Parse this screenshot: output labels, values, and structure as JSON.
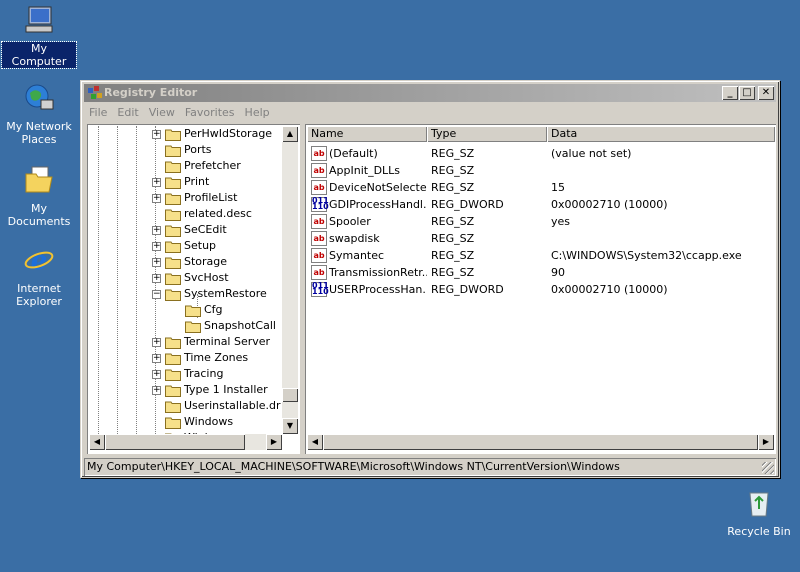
{
  "desktop": {
    "icons": [
      {
        "label": "My Computer"
      },
      {
        "label": "My Network Places"
      },
      {
        "label": "My Documents"
      },
      {
        "label": "Internet Explorer"
      },
      {
        "label": "Recycle Bin"
      }
    ]
  },
  "window": {
    "title": "Registry Editor",
    "controls": {
      "minimize": "_",
      "maximize": "□",
      "close": "✕"
    },
    "menu": [
      "File",
      "Edit",
      "View",
      "Favorites",
      "Help"
    ],
    "tree": {
      "items": [
        {
          "label": "PerHwIdStorage",
          "expander": "+"
        },
        {
          "label": "Ports",
          "expander": ""
        },
        {
          "label": "Prefetcher",
          "expander": ""
        },
        {
          "label": "Print",
          "expander": "+"
        },
        {
          "label": "ProfileList",
          "expander": "+"
        },
        {
          "label": "related.desc",
          "expander": ""
        },
        {
          "label": "SeCEdit",
          "expander": "+"
        },
        {
          "label": "Setup",
          "expander": "+"
        },
        {
          "label": "Storage",
          "expander": "+"
        },
        {
          "label": "SvcHost",
          "expander": "+"
        },
        {
          "label": "SystemRestore",
          "expander": "−"
        },
        {
          "label": "Cfg",
          "expander": ""
        },
        {
          "label": "SnapshotCall",
          "expander": ""
        },
        {
          "label": "Terminal Server",
          "expander": "+"
        },
        {
          "label": "Time Zones",
          "expander": "+"
        },
        {
          "label": "Tracing",
          "expander": "+"
        },
        {
          "label": "Type 1 Installer",
          "expander": "+"
        },
        {
          "label": "Userinstallable.dr",
          "expander": ""
        },
        {
          "label": "Windows",
          "expander": ""
        },
        {
          "label": "Winlogon",
          "expander": "+"
        }
      ]
    },
    "list": {
      "columns": [
        "Name",
        "Type",
        "Data"
      ],
      "rows": [
        {
          "icon": "ab",
          "name": "(Default)",
          "type": "REG_SZ",
          "data": "(value not set)"
        },
        {
          "icon": "ab",
          "name": "AppInit_DLLs",
          "type": "REG_SZ",
          "data": ""
        },
        {
          "icon": "ab",
          "name": "DeviceNotSelecte...",
          "type": "REG_SZ",
          "data": "15"
        },
        {
          "icon": "bin",
          "name": "GDIProcessHandl...",
          "type": "REG_DWORD",
          "data": "0x00002710 (10000)"
        },
        {
          "icon": "ab",
          "name": "Spooler",
          "type": "REG_SZ",
          "data": "yes"
        },
        {
          "icon": "ab",
          "name": "swapdisk",
          "type": "REG_SZ",
          "data": ""
        },
        {
          "icon": "ab",
          "name": "Symantec",
          "type": "REG_SZ",
          "data": "C:\\WINDOWS\\System32\\ccapp.exe"
        },
        {
          "icon": "ab",
          "name": "TransmissionRetr...",
          "type": "REG_SZ",
          "data": "90"
        },
        {
          "icon": "bin",
          "name": "USERProcessHan...",
          "type": "REG_DWORD",
          "data": "0x00002710 (10000)"
        }
      ]
    },
    "status": "My Computer\\HKEY_LOCAL_MACHINE\\SOFTWARE\\Microsoft\\Windows NT\\CurrentVersion\\Windows"
  }
}
